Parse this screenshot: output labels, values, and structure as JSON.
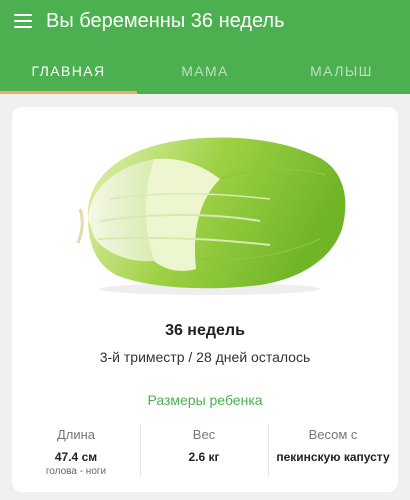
{
  "header": {
    "title": "Вы беременны 36 недель"
  },
  "tabs": [
    {
      "label": "ГЛАВНАЯ",
      "active": true
    },
    {
      "label": "МАМА"
    },
    {
      "label": "МАЛЫШ"
    }
  ],
  "colors": {
    "accent": "#4cb050",
    "tab_indicator": "#f6a963"
  },
  "card": {
    "image_icon": "napa-cabbage",
    "week": "36 недель",
    "trimester": "3-й триместр / 28 дней осталось",
    "sizes_heading": "Размеры ребенка",
    "stats": {
      "length": {
        "label": "Длина",
        "value": "47.4 см",
        "note": "голова - ноги"
      },
      "weight": {
        "label": "Вес",
        "value": "2.6 кг"
      },
      "compare": {
        "label": "Весом с",
        "value": "пекинскую капусту"
      }
    }
  }
}
